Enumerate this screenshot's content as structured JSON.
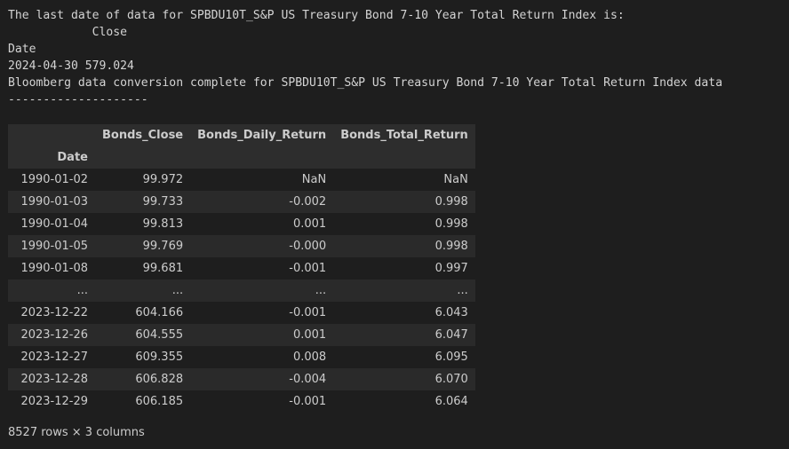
{
  "output": {
    "lines": [
      "The last date of data for SPBDU10T_S&P US Treasury Bond 7-10 Year Total Return Index is:",
      "            Close",
      "Date",
      "2024-04-30 579.024",
      "Bloomberg data conversion complete for SPBDU10T_S&P US Treasury Bond 7-10 Year Total Return Index data",
      "--------------------"
    ]
  },
  "dataframe": {
    "columns": [
      "Bonds_Close",
      "Bonds_Daily_Return",
      "Bonds_Total_Return"
    ],
    "index_name": "Date",
    "rows": [
      [
        "1990-01-02",
        "99.972",
        "NaN",
        "NaN"
      ],
      [
        "1990-01-03",
        "99.733",
        "-0.002",
        "0.998"
      ],
      [
        "1990-01-04",
        "99.813",
        "0.001",
        "0.998"
      ],
      [
        "1990-01-05",
        "99.769",
        "-0.000",
        "0.998"
      ],
      [
        "1990-01-08",
        "99.681",
        "-0.001",
        "0.997"
      ],
      [
        "...",
        "...",
        "...",
        "..."
      ],
      [
        "2023-12-22",
        "604.166",
        "-0.001",
        "6.043"
      ],
      [
        "2023-12-26",
        "604.555",
        "0.001",
        "6.047"
      ],
      [
        "2023-12-27",
        "609.355",
        "0.008",
        "6.095"
      ],
      [
        "2023-12-28",
        "606.828",
        "-0.004",
        "6.070"
      ],
      [
        "2023-12-29",
        "606.185",
        "-0.001",
        "6.064"
      ]
    ],
    "shape_text": "8527 rows × 3 columns"
  }
}
